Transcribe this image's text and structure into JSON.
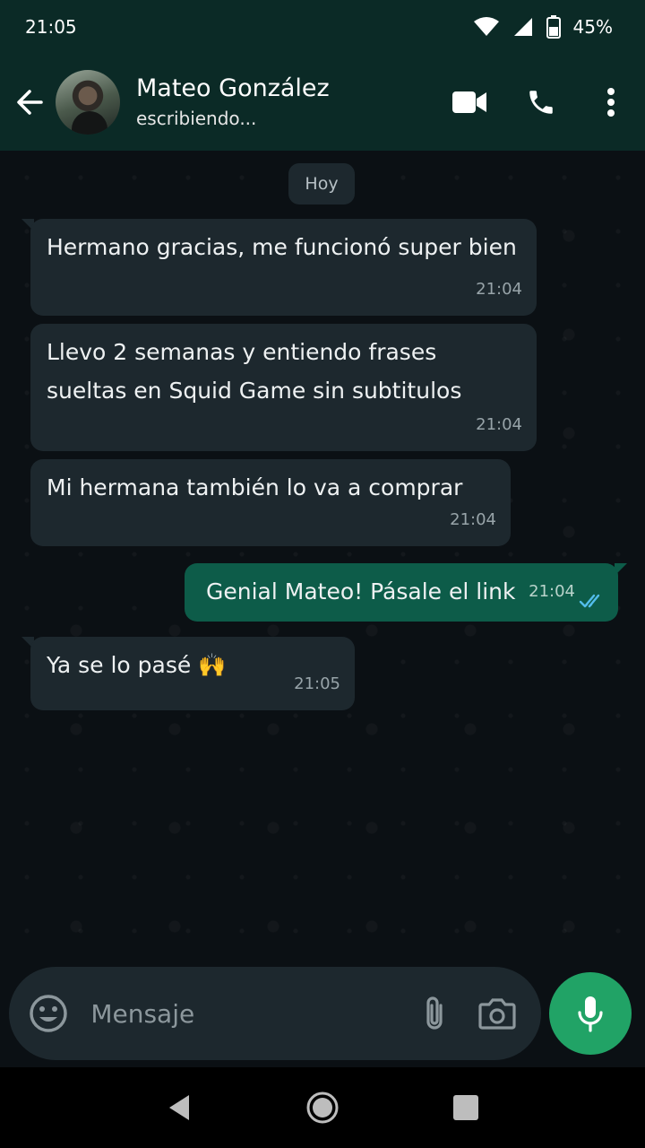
{
  "status_bar": {
    "time": "21:05",
    "battery": "45%"
  },
  "header": {
    "contact_name": "Mateo González",
    "contact_status": "escribiendo...",
    "icons": [
      "back-arrow-icon",
      "video-call-icon",
      "phone-icon",
      "more-vert-icon"
    ]
  },
  "chat": {
    "day_label": "Hoy",
    "messages": [
      {
        "direction": "in",
        "text": "Hermano gracias, me funcionó super bien",
        "time": "21:04"
      },
      {
        "direction": "in",
        "text": "Llevo 2 semanas y entiendo frases sueltas en Squid Game sin subtitulos",
        "time": "21:04"
      },
      {
        "direction": "in",
        "text": "Mi hermana también lo va a comprar",
        "time": "21:04"
      },
      {
        "direction": "out",
        "text": "Genial Mateo! Pásale el link",
        "time": "21:04",
        "status": "read"
      },
      {
        "direction": "in",
        "text": "Ya se lo pasé 🙌",
        "time": "21:05"
      }
    ]
  },
  "composer": {
    "placeholder": "Mensaje"
  },
  "colors": {
    "header_bg": "#0b2a26",
    "chat_bg": "#0b1014",
    "incoming_bubble": "#1d282e",
    "outgoing_bubble": "#0d5c49",
    "accent": "#21a366",
    "read_ticks": "#53bdeb"
  }
}
